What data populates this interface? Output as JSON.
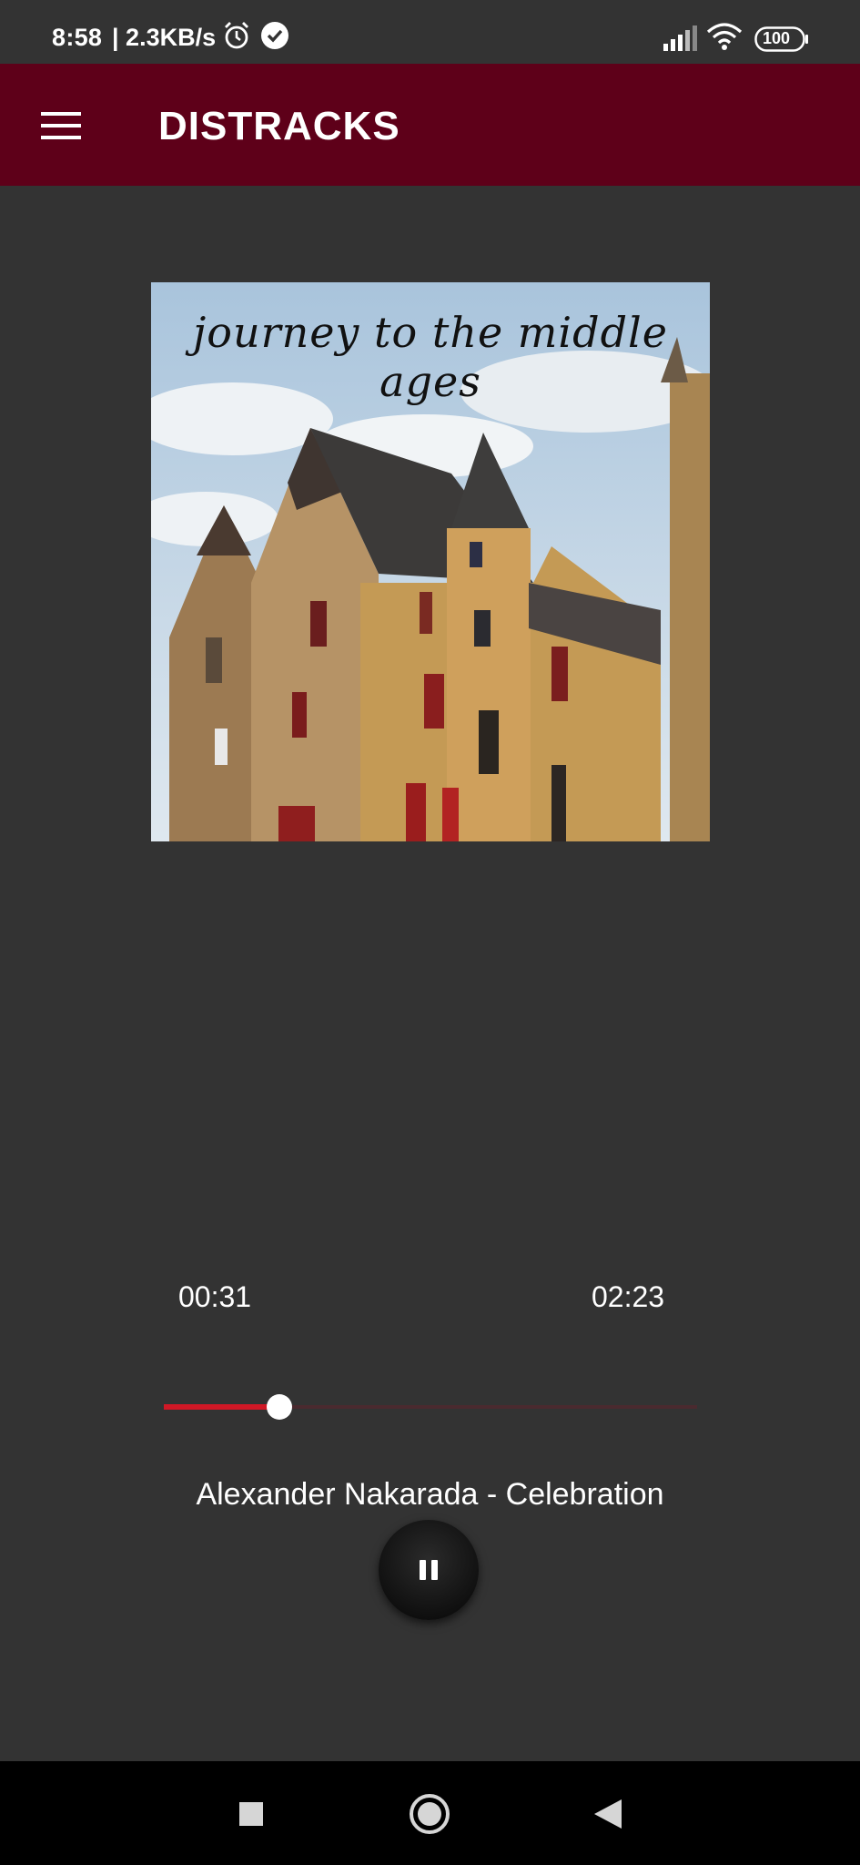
{
  "status_bar": {
    "time": "8:58",
    "network_speed": "| 2.3KB/s",
    "battery": "100",
    "icons": [
      "alarm-icon",
      "check-circle-icon",
      "signal-icon",
      "wifi-icon",
      "battery-icon"
    ]
  },
  "app_bar": {
    "title": "DISTRACKS",
    "menu_icon": "hamburger-menu-icon",
    "background": "#5e0019"
  },
  "player": {
    "album_title_art": "journey to the middle ages",
    "elapsed": "00:31",
    "total": "02:23",
    "progress": 0.2168,
    "progress_color": "#d01826",
    "track": "Alexander Nakarada - Celebration",
    "control_icon": "pause-icon"
  },
  "nav_bar": {
    "buttons": [
      "recents-square-icon",
      "home-circle-icon",
      "back-triangle-icon"
    ]
  }
}
